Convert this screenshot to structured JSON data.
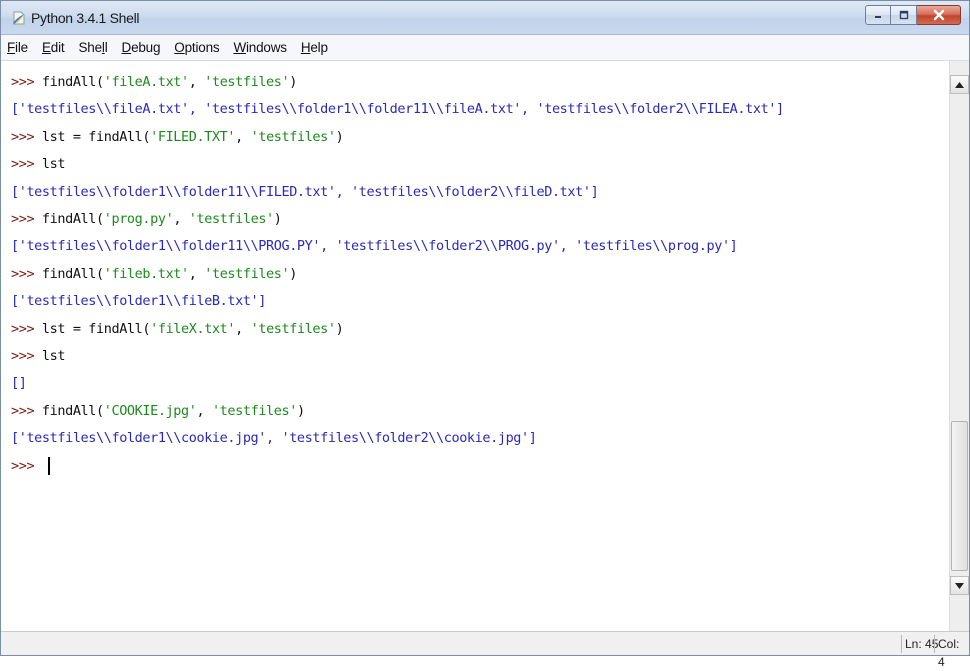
{
  "window": {
    "title": "Python 3.4.1 Shell",
    "icon": "python-feather-icon"
  },
  "menu": {
    "items": [
      {
        "label": "File",
        "underline": "F",
        "rest": "ile"
      },
      {
        "label": "Edit",
        "underline": "E",
        "rest": "dit"
      },
      {
        "label": "Shell",
        "pre": "She",
        "underline": "l",
        "rest": "l"
      },
      {
        "label": "Debug",
        "underline": "D",
        "rest": "ebug"
      },
      {
        "label": "Options",
        "underline": "O",
        "rest": "ptions"
      },
      {
        "label": "Windows",
        "underline": "W",
        "rest": "indows"
      },
      {
        "label": "Help",
        "underline": "H",
        "rest": "elp"
      }
    ]
  },
  "shell": {
    "prompt": ">>>",
    "lines": [
      {
        "type": "input",
        "code": "findAll(",
        "args": [
          "'fileA.txt'",
          "'testfiles'"
        ],
        "close": ")"
      },
      {
        "type": "output",
        "text": "['testfiles\\\\fileA.txt', 'testfiles\\\\folder1\\\\folder11\\\\fileA.txt', 'testfiles\\\\folder2\\\\FILEA.txt']"
      },
      {
        "type": "input",
        "code": "lst = findAll(",
        "args": [
          "'FILED.TXT'",
          "'testfiles'"
        ],
        "close": ")"
      },
      {
        "type": "input",
        "code": "lst",
        "args": [],
        "close": ""
      },
      {
        "type": "output",
        "text": "['testfiles\\\\folder1\\\\folder11\\\\FILED.txt', 'testfiles\\\\folder2\\\\fileD.txt']"
      },
      {
        "type": "input",
        "code": "findAll(",
        "args": [
          "'prog.py'",
          "'testfiles'"
        ],
        "close": ")"
      },
      {
        "type": "output",
        "text": "['testfiles\\\\folder1\\\\folder11\\\\PROG.PY', 'testfiles\\\\folder2\\\\PROG.py', 'testfiles\\\\prog.py']"
      },
      {
        "type": "input",
        "code": "findAll(",
        "args": [
          "'fileb.txt'",
          "'testfiles'"
        ],
        "close": ")"
      },
      {
        "type": "output",
        "text": "['testfiles\\\\folder1\\\\fileB.txt']"
      },
      {
        "type": "input",
        "code": "lst = findAll(",
        "args": [
          "'fileX.txt'",
          "'testfiles'"
        ],
        "close": ")"
      },
      {
        "type": "input",
        "code": "lst",
        "args": [],
        "close": ""
      },
      {
        "type": "output",
        "text": "[]"
      },
      {
        "type": "input",
        "code": "findAll(",
        "args": [
          "'COOKIE.jpg'",
          "'testfiles'"
        ],
        "close": ")"
      },
      {
        "type": "output",
        "text": "['testfiles\\\\folder1\\\\cookie.jpg', 'testfiles\\\\folder2\\\\cookie.jpg']"
      },
      {
        "type": "current",
        "code": "",
        "args": [],
        "close": ""
      }
    ]
  },
  "status": {
    "ln": "Ln: 45",
    "col": "Col: 4"
  },
  "colors": {
    "prompt": "#7a1d13",
    "string": "#1e8a1e",
    "output": "#2a2ab8"
  }
}
